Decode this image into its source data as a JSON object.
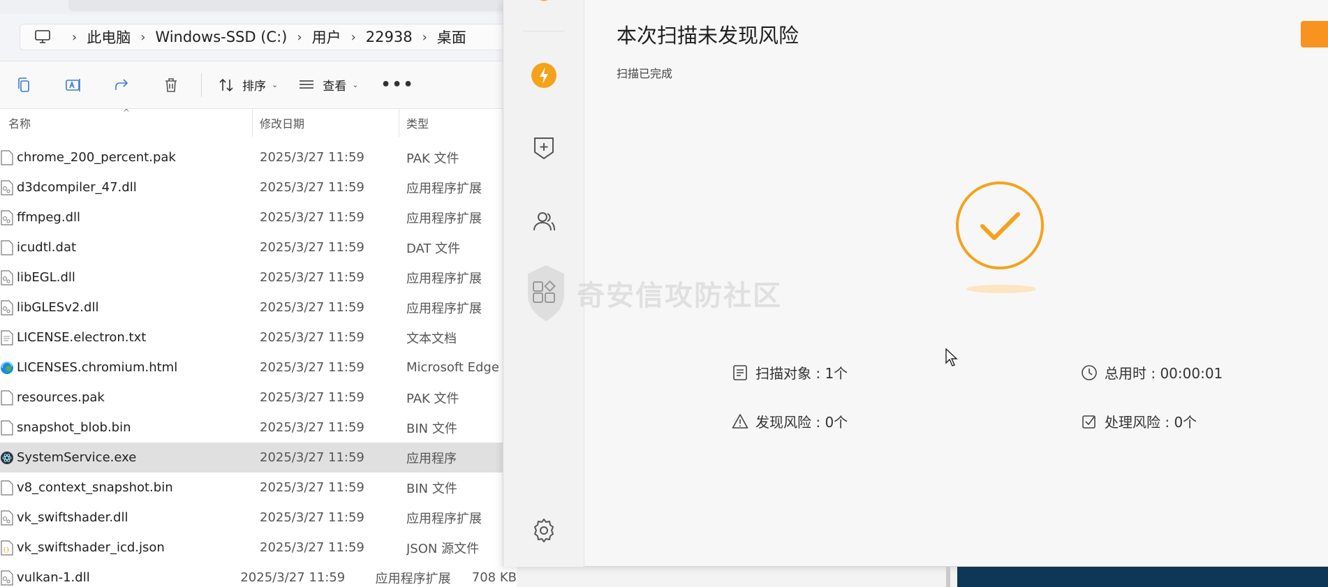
{
  "explorer": {
    "breadcrumb": [
      "此电脑",
      "Windows-SSD (C:)",
      "用户",
      "22938",
      "桌面"
    ],
    "toolbar": {
      "sort_label": "排序",
      "view_label": "查看",
      "more_label": "•••"
    },
    "columns": {
      "name": "名称",
      "date": "修改日期",
      "type": "类型"
    },
    "files": [
      {
        "name": "chrome_200_percent.pak",
        "date": "2025/3/27 11:59",
        "type": "PAK 文件",
        "size": "",
        "icon": "file"
      },
      {
        "name": "d3dcompiler_47.dll",
        "date": "2025/3/27 11:59",
        "type": "应用程序扩展",
        "size": "",
        "icon": "dll"
      },
      {
        "name": "ffmpeg.dll",
        "date": "2025/3/27 11:59",
        "type": "应用程序扩展",
        "size": "",
        "icon": "dll"
      },
      {
        "name": "icudtl.dat",
        "date": "2025/3/27 11:59",
        "type": "DAT 文件",
        "size": "",
        "icon": "file"
      },
      {
        "name": "libEGL.dll",
        "date": "2025/3/27 11:59",
        "type": "应用程序扩展",
        "size": "",
        "icon": "dll"
      },
      {
        "name": "libGLESv2.dll",
        "date": "2025/3/27 11:59",
        "type": "应用程序扩展",
        "size": "",
        "icon": "dll"
      },
      {
        "name": "LICENSE.electron.txt",
        "date": "2025/3/27 11:59",
        "type": "文本文档",
        "size": "",
        "icon": "txt"
      },
      {
        "name": "LICENSES.chromium.html",
        "date": "2025/3/27 11:59",
        "type": "Microsoft Edge",
        "size": "",
        "icon": "edge"
      },
      {
        "name": "resources.pak",
        "date": "2025/3/27 11:59",
        "type": "PAK 文件",
        "size": "",
        "icon": "file"
      },
      {
        "name": "snapshot_blob.bin",
        "date": "2025/3/27 11:59",
        "type": "BIN 文件",
        "size": "",
        "icon": "file"
      },
      {
        "name": "SystemService.exe",
        "date": "2025/3/27 11:59",
        "type": "应用程序",
        "size": "",
        "icon": "exe",
        "selected": true
      },
      {
        "name": "v8_context_snapshot.bin",
        "date": "2025/3/27 11:59",
        "type": "BIN 文件",
        "size": "",
        "icon": "file"
      },
      {
        "name": "vk_swiftshader.dll",
        "date": "2025/3/27 11:59",
        "type": "应用程序扩展",
        "size": "",
        "icon": "dll"
      },
      {
        "name": "vk_swiftshader_icd.json",
        "date": "2025/3/27 11:59",
        "type": "JSON 源文件",
        "size": "",
        "icon": "json"
      },
      {
        "name": "vulkan-1.dll",
        "date": "2025/3/27 11:59",
        "type": "应用程序扩展",
        "size": "708 KB",
        "icon": "dll"
      }
    ]
  },
  "security": {
    "title": "本次扫描未发现风险",
    "subtitle": "扫描已完成",
    "watermark": "奇安信攻防社区",
    "stats": {
      "scan_objects": "扫描对象 : 1个",
      "total_time": "总用时 : 00:00:01",
      "found_risks": "发现风险 : 0个",
      "handled_risks": "处理风险 : 0个"
    },
    "colors": {
      "accent": "#f7931e",
      "check": "#f5a21b"
    }
  }
}
